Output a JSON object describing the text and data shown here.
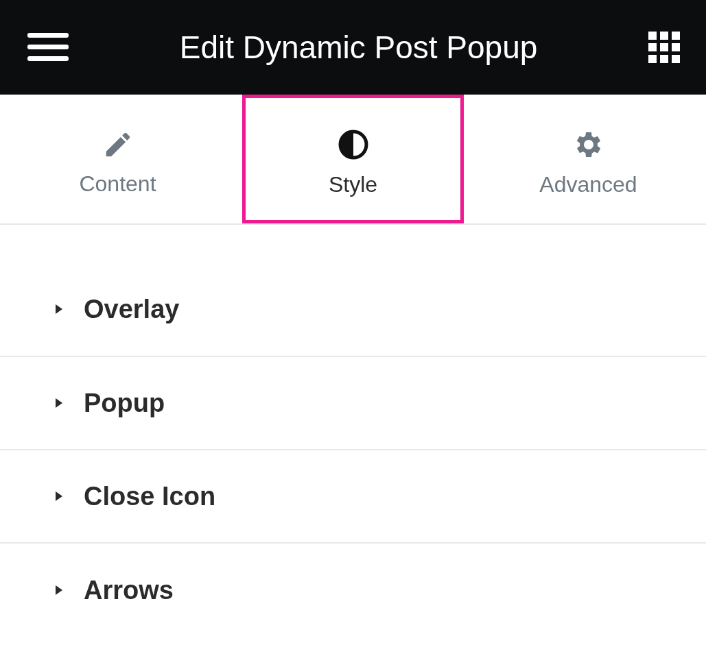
{
  "header": {
    "title": "Edit Dynamic Post Popup"
  },
  "tabs": [
    {
      "label": "Content",
      "kind": "pencil",
      "selected": false
    },
    {
      "label": "Style",
      "kind": "contrast",
      "selected": true
    },
    {
      "label": "Advanced",
      "kind": "gear",
      "selected": false
    }
  ],
  "sections": [
    {
      "label": "Overlay",
      "expanded": false
    },
    {
      "label": "Popup",
      "expanded": false
    },
    {
      "label": "Close Icon",
      "expanded": false
    },
    {
      "label": "Arrows",
      "expanded": false
    }
  ]
}
